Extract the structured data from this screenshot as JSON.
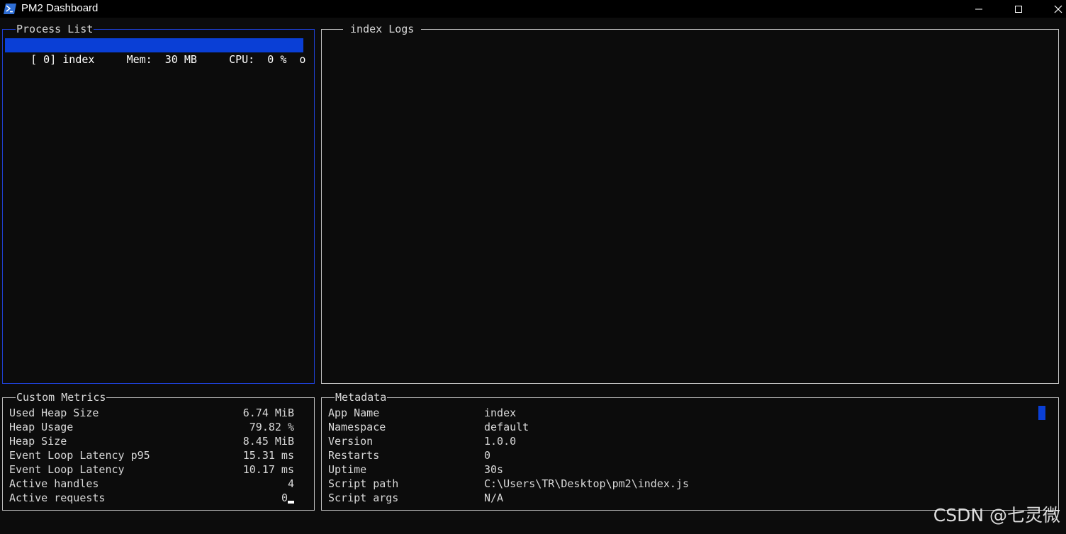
{
  "window": {
    "title": "PM2 Dashboard",
    "minimize_icon": "minimize-icon",
    "maximize_icon": "maximize-icon",
    "close_icon": "close-icon"
  },
  "process_list": {
    "title": "Process List",
    "rows": [
      {
        "text": "[ 0] index     Mem:  30 MB     CPU:  0 %  o"
      }
    ]
  },
  "logs": {
    "title": " index Logs "
  },
  "metrics": {
    "title": "Custom Metrics",
    "items": [
      {
        "label": "Used Heap Size",
        "value": "6.74 MiB"
      },
      {
        "label": "Heap Usage",
        "value": "79.82 %"
      },
      {
        "label": "Heap Size",
        "value": "8.45 MiB"
      },
      {
        "label": "Event Loop Latency p95",
        "value": "15.31 ms"
      },
      {
        "label": "Event Loop Latency",
        "value": "10.17 ms"
      },
      {
        "label": "Active handles",
        "value": "4"
      },
      {
        "label": "Active requests",
        "value": "0"
      }
    ]
  },
  "metadata": {
    "title": "Metadata",
    "items": [
      {
        "label": "App Name",
        "value": "index"
      },
      {
        "label": "Namespace",
        "value": "default"
      },
      {
        "label": "Version",
        "value": "1.0.0"
      },
      {
        "label": "Restarts",
        "value": "0"
      },
      {
        "label": "Uptime",
        "value": "30s"
      },
      {
        "label": "Script path",
        "value": "C:\\Users\\TR\\Desktop\\pm2\\index.js"
      },
      {
        "label": "Script args",
        "value": "N/A"
      }
    ]
  },
  "watermark": "CSDN @七灵微",
  "colors": {
    "accent": "#0a3fd6",
    "border": "#bdbdbd",
    "background": "#0c0c0c"
  }
}
